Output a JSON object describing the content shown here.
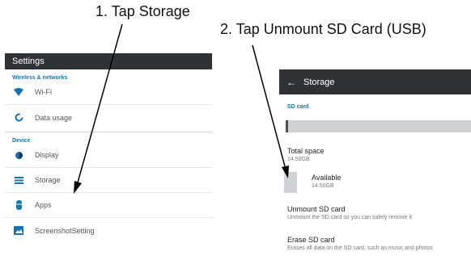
{
  "captions": {
    "step1": "1. Tap Storage",
    "step2": "2. Tap Unmount SD Card (USB)"
  },
  "settings": {
    "title": "Settings",
    "section_wireless": "Wireless & networks",
    "wifi": "Wi-Fi",
    "data_usage": "Data usage",
    "section_device": "Device",
    "display": "Display",
    "storage": "Storage",
    "apps": "Apps",
    "screenshot": "ScreenshotSetting"
  },
  "storage": {
    "back_icon": "arrow-left-icon",
    "title": "Storage",
    "section": "SD card",
    "used_fraction": 0.01,
    "total_label": "Total space",
    "total_value": "14.50GB",
    "available_label": "Available",
    "available_value": "14.50GB",
    "unmount_title": "Unmount SD card",
    "unmount_sub": "Unmount the SD card so you can safely remove it",
    "erase_title": "Erase SD card",
    "erase_sub": "Erases all data on the SD card, such as music and photos"
  },
  "colors": {
    "appbar": "#2f3336",
    "accent": "#1a73a8",
    "bar_free": "#cfd2d4",
    "bar_used": "#4a4f52"
  },
  "icons": [
    "wifi-icon",
    "data-usage-icon",
    "display-icon",
    "storage-icon",
    "apps-icon",
    "screenshot-icon"
  ]
}
